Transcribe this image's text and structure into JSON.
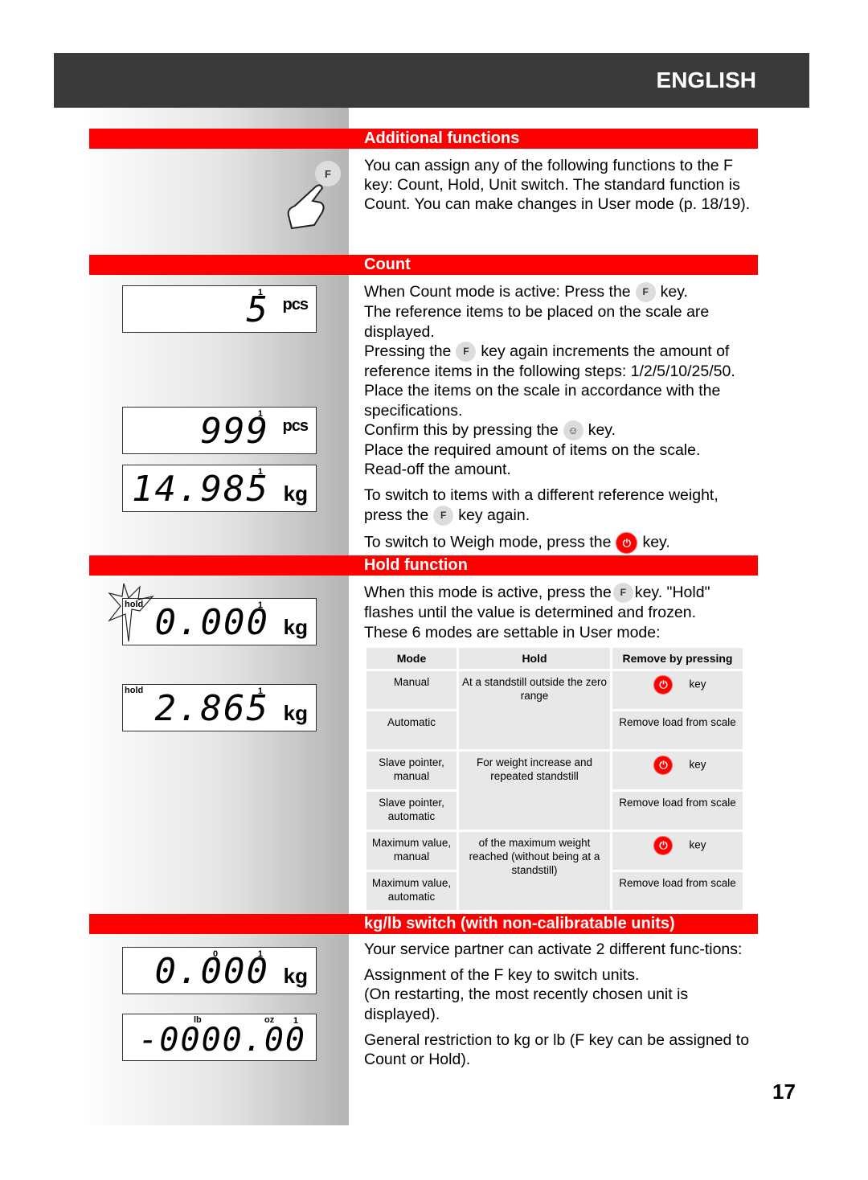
{
  "header": {
    "language": "ENGLISH"
  },
  "sections": {
    "additional": {
      "title": "Additional functions",
      "body": "You can assign any of the following functions to the F key:  Count, Hold, Unit switch. The standard function is Count. You can make changes in User mode (p. 18/19).",
      "key_label": "F"
    },
    "count": {
      "title": "Count",
      "p1a": "When Count mode is active: Press the",
      "p1b": "key.",
      "p2": "The reference items to be placed on the scale are displayed.",
      "p3a": "Pressing the",
      "p3b": "key again increments the amount of reference items in the following steps: 1/2/5/10/25/50.",
      "p4": "Place the items on the scale in accordance with the specifications.",
      "p5a": "Confirm this by pressing the",
      "p5b": "key.",
      "p6": "Place the required amount of items on the scale.",
      "p7": "Read-off the amount.",
      "p8a": "To switch to items with a different reference weight, press the",
      "p8b": "key again.",
      "p9a": "To switch to Weigh mode, press the",
      "p9b": "key.",
      "displays": [
        {
          "value": "5",
          "unit": "pcs",
          "marker": "1"
        },
        {
          "value": "999",
          "unit": "pcs",
          "marker": "1"
        },
        {
          "value": "14.985",
          "unit": "kg",
          "marker": "1"
        }
      ]
    },
    "hold": {
      "title": "Hold function",
      "p1a": "When this mode is active, press the",
      "p1b": "key. \"Hold\" flashes until the value is determined and frozen.",
      "p2": "These 6 modes are settable in User mode:",
      "displays": [
        {
          "value": "0.000",
          "unit": "kg",
          "flag": "hold",
          "marker": "1"
        },
        {
          "value": "2.865",
          "unit": "kg",
          "flag": "hold",
          "marker": "1"
        }
      ],
      "table": {
        "headers": [
          "Mode",
          "Hold",
          "Remove by pressing"
        ],
        "rows": [
          {
            "mode": "Manual",
            "hold": "At a standstill outside the zero range",
            "remove": "key",
            "remove_icon": "power-key"
          },
          {
            "mode": "Automatic",
            "remove": "Remove load from scale"
          },
          {
            "mode": "Slave pointer, manual",
            "hold": "For weight increase and repeated standstill",
            "remove": "key",
            "remove_icon": "power-key"
          },
          {
            "mode": "Slave pointer, automatic",
            "remove": "Remove load from scale"
          },
          {
            "mode": "Maximum value, manual",
            "hold": "of the maximum weight reached (without being at a standstill)",
            "remove": "key",
            "remove_icon": "power-key"
          },
          {
            "mode": "Maximum value, automatic",
            "remove": "Remove load from scale"
          }
        ]
      }
    },
    "kglb": {
      "title": "kg/lb switch (with non-calibratable units)",
      "p1": "Your service partner can activate 2 different func-tions:",
      "p2": "Assignment of the F key to switch units.",
      "p3": "(On restarting, the most recently chosen unit is displayed).",
      "p4": "General restriction to kg or lb (F key can be assigned to Count or Hold).",
      "displays": [
        {
          "value": "0.000",
          "unit": "kg",
          "zero": "0",
          "marker": "1"
        },
        {
          "value": "-0000.00",
          "lb": "lb",
          "oz": "oz",
          "marker": "1"
        }
      ]
    }
  },
  "keys": {
    "f": "F",
    "tare": "☺",
    "power": "⏻"
  },
  "colors": {
    "accent": "#fe0000",
    "header": "#3a3a3a"
  },
  "page_number": "17"
}
